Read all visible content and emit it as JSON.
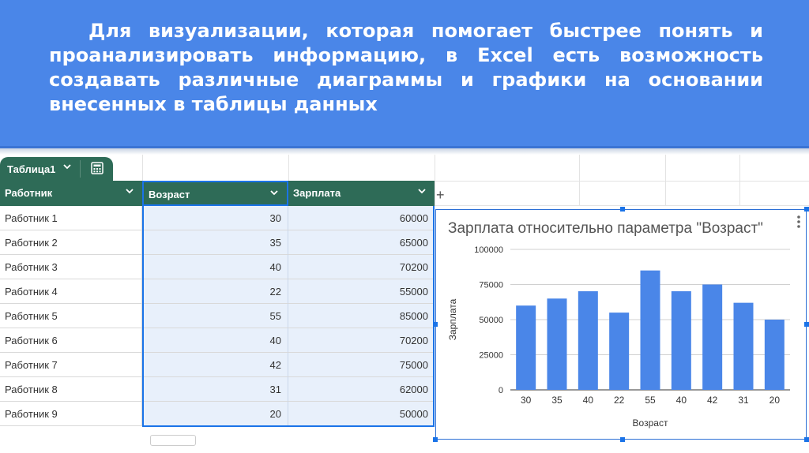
{
  "banner": {
    "text": "Для визуализации, которая помогает быстрее понять и проанализировать информацию, в Excel есть возможность создавать различные диаграммы и графики на основании внесенных в таблицы данных"
  },
  "sheet": {
    "table_name": "Таблица1",
    "columns": [
      "Работник",
      "Возраст",
      "Зарплата"
    ],
    "rows": [
      [
        "Работник 1",
        "30",
        "60000"
      ],
      [
        "Работник 2",
        "35",
        "65000"
      ],
      [
        "Работник 3",
        "40",
        "70200"
      ],
      [
        "Работник 4",
        "22",
        "55000"
      ],
      [
        "Работник 5",
        "55",
        "85000"
      ],
      [
        "Работник 6",
        "40",
        "70200"
      ],
      [
        "Работник 7",
        "42",
        "75000"
      ],
      [
        "Работник 8",
        "31",
        "62000"
      ],
      [
        "Работник 9",
        "20",
        "50000"
      ]
    ],
    "add_column_symbol": "+",
    "icons": [
      "chevron-down-icon",
      "calculator-icon",
      "more-vert-icon"
    ]
  },
  "colors": {
    "banner": "#4a86e8",
    "table_header": "#2e6b57",
    "bar": "#4a86e8",
    "selection": "#1a73e8"
  },
  "chart_data": {
    "type": "bar",
    "title": "Зарплата относительно параметра \"Возраст\"",
    "xlabel": "Возраст",
    "ylabel": "Зарплата",
    "categories": [
      "30",
      "35",
      "40",
      "22",
      "55",
      "40",
      "42",
      "31",
      "20"
    ],
    "values": [
      60000,
      65000,
      70200,
      55000,
      85000,
      70200,
      75000,
      62000,
      50000
    ],
    "ylim": [
      0,
      100000
    ],
    "yticks": [
      "0",
      "25000",
      "50000",
      "75000",
      "100000"
    ],
    "grid": true,
    "legend": "none"
  }
}
